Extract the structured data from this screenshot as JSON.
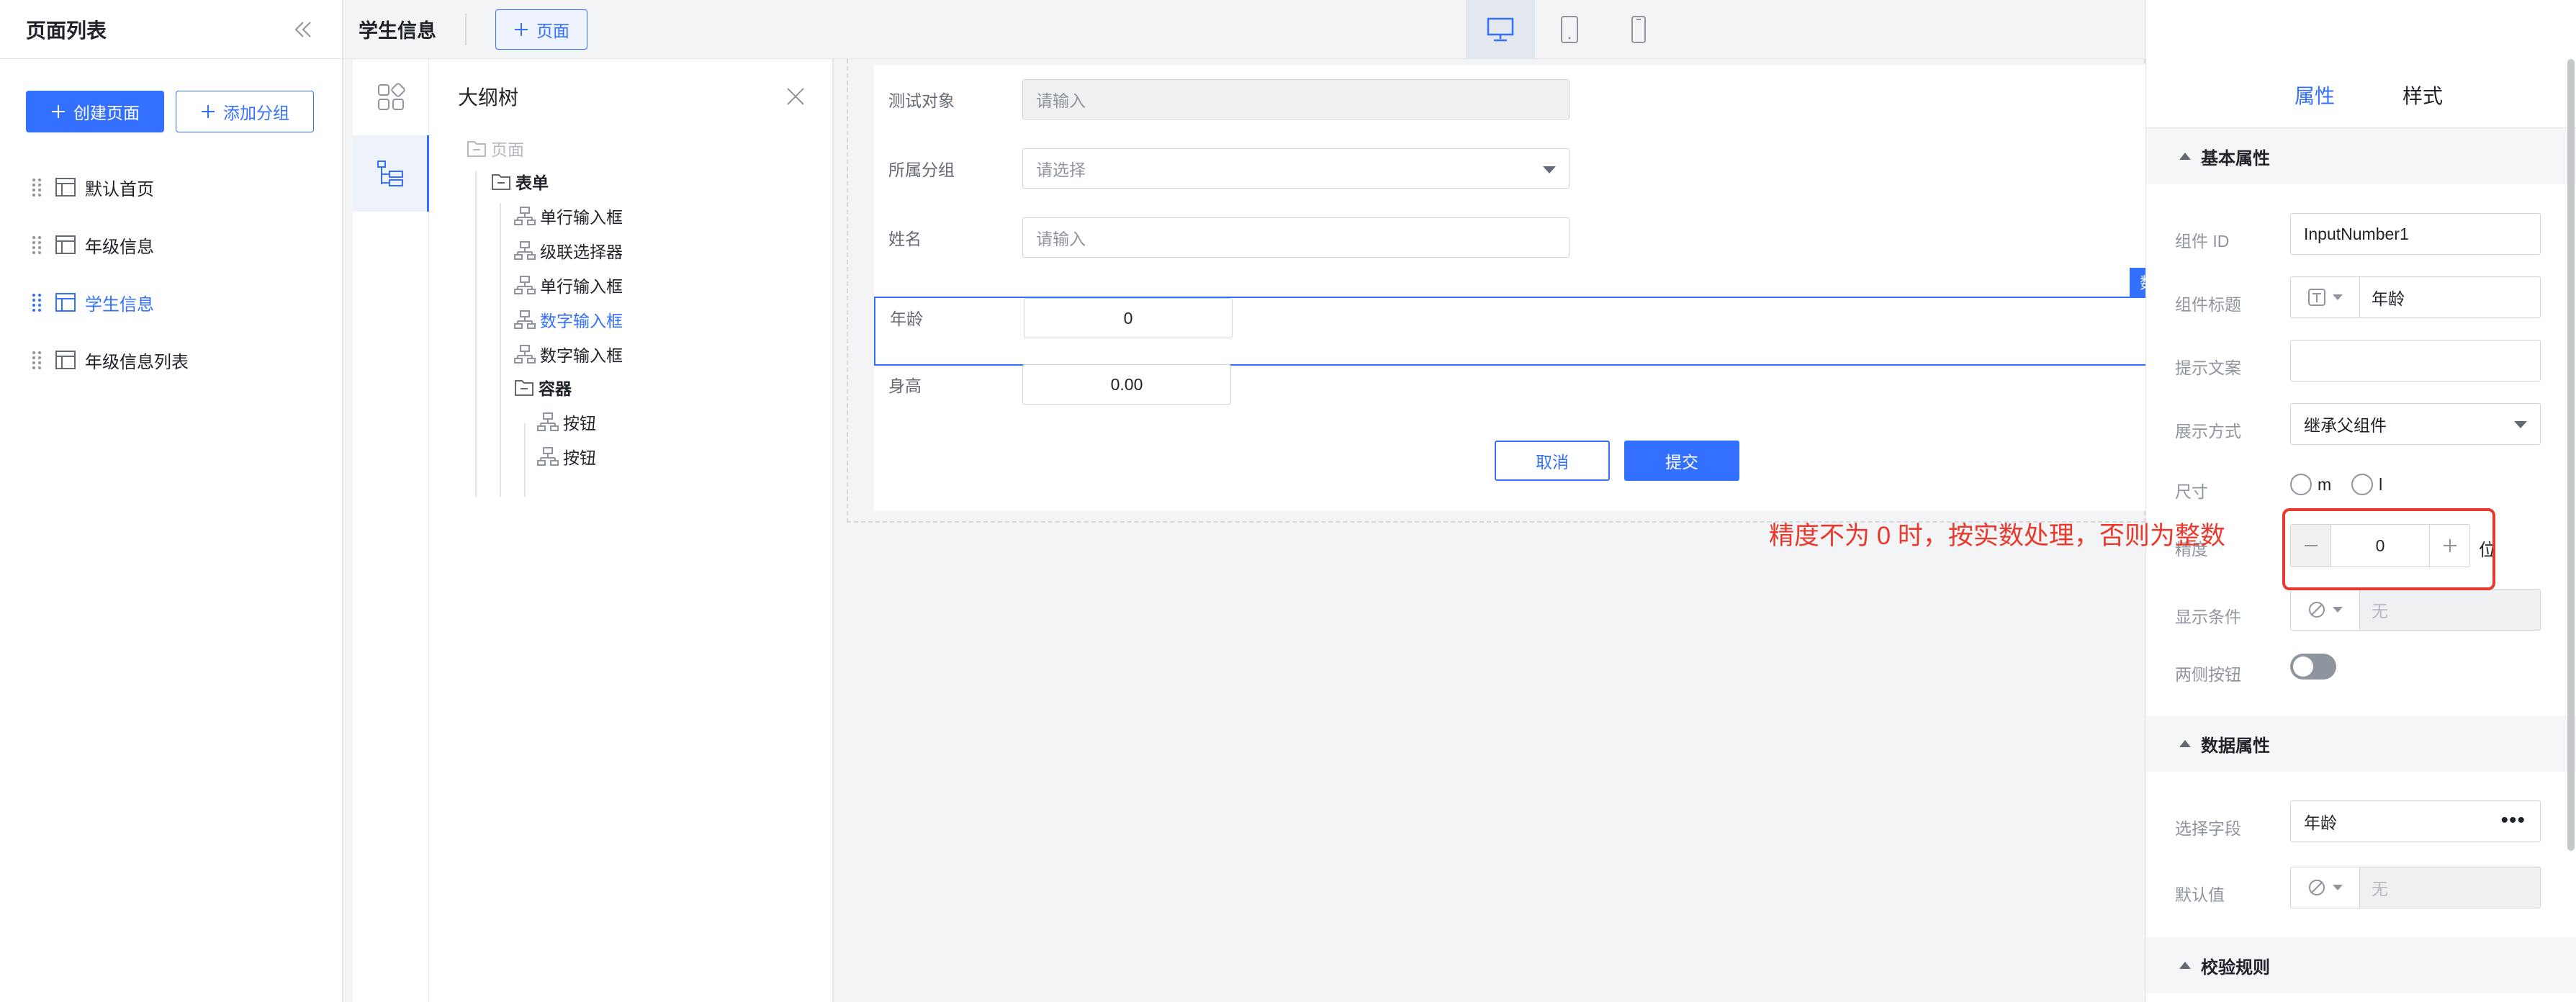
{
  "sidebar": {
    "title": "页面列表",
    "create_label": "创建页面",
    "add_group_label": "添加分组",
    "items": [
      {
        "label": "默认首页"
      },
      {
        "label": "年级信息"
      },
      {
        "label": "学生信息"
      },
      {
        "label": "年级信息列表"
      }
    ]
  },
  "topbar": {
    "title": "学生信息",
    "add_page_label": "页面"
  },
  "outline": {
    "title": "大纲树",
    "nodes": [
      {
        "label": "页面"
      },
      {
        "label": "表单"
      },
      {
        "label": "单行输入框"
      },
      {
        "label": "级联选择器"
      },
      {
        "label": "单行输入框"
      },
      {
        "label": "数字输入框"
      },
      {
        "label": "数字输入框"
      },
      {
        "label": "容器"
      },
      {
        "label": "按钮"
      },
      {
        "label": "按钮"
      }
    ]
  },
  "form": {
    "fields": [
      {
        "label": "测试对象",
        "placeholder": "请输入"
      },
      {
        "label": "所属分组",
        "placeholder": "请选择"
      },
      {
        "label": "姓名",
        "placeholder": "请输入"
      },
      {
        "label": "年龄",
        "value": "0"
      },
      {
        "label": "身高",
        "value": "0.00"
      }
    ],
    "selected_tag": "数",
    "cancel_label": "取消",
    "submit_label": "提交"
  },
  "props": {
    "tabs": [
      "属性",
      "样式"
    ],
    "basic_section": "基本属性",
    "component_id_label": "组件 ID",
    "component_id": "InputNumber1",
    "component_title_label": "组件标题",
    "component_title": "年龄",
    "hint_label": "提示文案",
    "display_mode_label": "展示方式",
    "display_mode": "继承父组件",
    "size_label": "尺寸",
    "size_options": [
      "m",
      "l"
    ],
    "precision_label": "精度",
    "precision_value": "0",
    "precision_unit": "位",
    "annotation": "精度不为 0 时，按实数处理，否则为整数",
    "show_condition_label": "显示条件",
    "show_condition": "无",
    "side_buttons_label": "两侧按钮",
    "data_section": "数据属性",
    "field_label": "选择字段",
    "field_value": "年龄",
    "default_label": "默认值",
    "default_value": "无",
    "validation_section": "校验规则"
  },
  "colors": {
    "accent": "#3370ff",
    "annotation": "#e8392c"
  }
}
